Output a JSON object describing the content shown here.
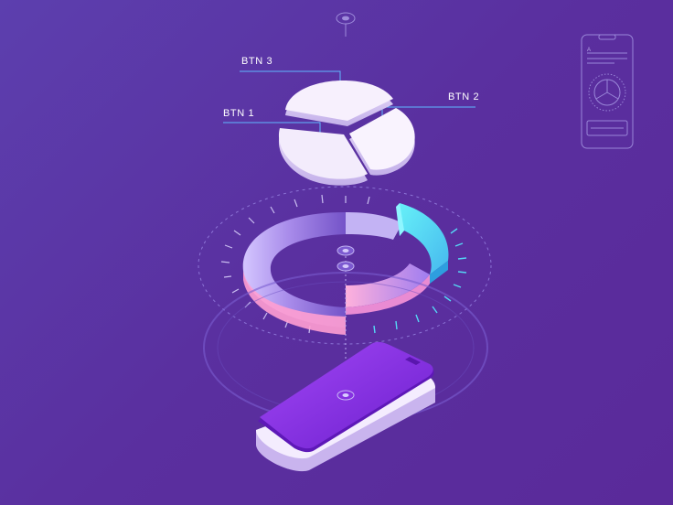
{
  "labels": {
    "btn3": "BTN 3",
    "btn2": "BTN 2",
    "btn1": "BTN 1"
  },
  "phone_wireframe": {
    "header_letter": "A"
  },
  "colors": {
    "background": "#5a2f9f",
    "callout_line": "#5fb8ff",
    "pie_face": "#f5eefc",
    "ring_cyan": "#55e3f3",
    "ring_pink": "#ff9bd0",
    "phone_screen": "#8a2ee0"
  }
}
